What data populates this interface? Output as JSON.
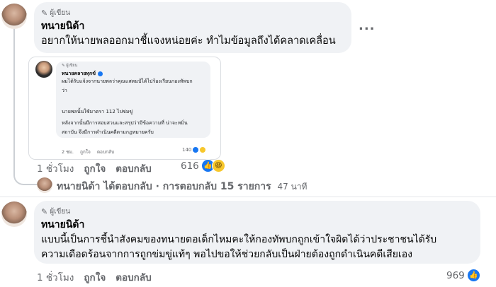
{
  "comment1": {
    "author_tag": "ผู้เขียน",
    "author_name": "ทนายนิด้า",
    "text": "อยากให้นายพลออกมาชี้แจงหน่อยค่ะ ทำไมข้อมูลถึงได้คลาดเคลื่อน",
    "more_label": "...",
    "embedded": {
      "author_tag": "ผู้เขียน",
      "author_name": "ทนายคลายทุกข์",
      "para1": "ผมได้รับแจ้งจากนายพลว่าคุณแสตมป์ได้ไปร้องเรียนกองทัพบกว่า",
      "para2": "นายพลนั้นใช้มาตรา 112 ไปข่มขู่",
      "para3": "หลังจากนั้นมีการสอบสวนและสรุปว่ามีข้อความที่ น่าจะหมิ่นสถาบัน จึงมีการดำเนินคดีตามกฎหมายครับ",
      "time": "2 ชม.",
      "like": "ถูกใจ",
      "reply": "ตอบกลับ",
      "count": "140"
    },
    "time": "1 ชั่วโมง",
    "like_label": "ถูกใจ",
    "reply_label": "ตอบกลับ",
    "reaction_count": "616"
  },
  "reply_summary": {
    "text": "ทนายนิด้า ได้ตอบกลับ · การตอบกลับ 15 รายการ",
    "time": "47 นาที"
  },
  "comment2": {
    "author_tag": "ผู้เขียน",
    "author_name": "ทนายนิด้า",
    "line1": "แบบนี้เป็นการชี้นำสังคมของทนายดอเด็กไหมคะให้กองทัพบกถูกเข้าใจผิดได้ว่าประชาชนได้รับ",
    "line2": "ความเดือดร้อนจากการถูกข่มขู่แท้ๆ พอไปขอให้ช่วยกลับเป็นฝ่ายต้องถูกดำเนินคดีเสียเอง",
    "time": "1 ชั่วโมง",
    "like_label": "ถูกใจ",
    "reply_label": "ตอบกลับ",
    "reaction_count": "969"
  }
}
